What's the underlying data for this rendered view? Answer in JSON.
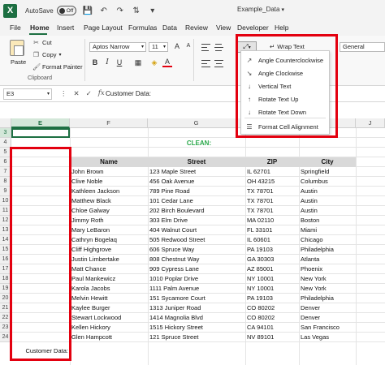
{
  "titlebar": {
    "logo": "X",
    "autosave_label": "AutoSave",
    "toggle_state": "Off",
    "filename": "Example_Data",
    "icons": [
      "save-icon",
      "undo-icon",
      "redo-icon",
      "sort-icon",
      "customize-icon"
    ]
  },
  "menu": {
    "tabs": [
      "File",
      "Home",
      "Insert",
      "Page Layout",
      "Formulas",
      "Data",
      "Review",
      "View",
      "Developer",
      "Help"
    ],
    "active": "Home"
  },
  "ribbon": {
    "paste_label": "Paste",
    "cut_label": "Cut",
    "copy_label": "Copy",
    "format_painter_label": "Format Painter",
    "clipboard_group": "Clipboard",
    "font_name": "Aptos Narrow",
    "font_size": "11",
    "font_group": "Font",
    "bold": "B",
    "italic": "I",
    "underline": "U",
    "grow_font": "A",
    "shrink_font": "A",
    "font_color_letter": "A",
    "wrap_text_label": "Wrap Text",
    "number_format": "General",
    "accent_color": "#1d6f42"
  },
  "orientation_menu": {
    "items": [
      "Angle Counterclockwise",
      "Angle Clockwise",
      "Vertical Text",
      "Rotate Text Up",
      "Rotate Text Down",
      "Format Cell Alignment"
    ]
  },
  "formula_bar": {
    "cell_ref": "E3",
    "content": "Customer Data:"
  },
  "sheet": {
    "columns": [
      "E",
      "F",
      "G",
      "H",
      "I",
      "J"
    ],
    "selected_column": "E",
    "rows": [
      "3",
      "4",
      "5",
      "6",
      "7",
      "8",
      "9",
      "10",
      "11",
      "12",
      "13",
      "14",
      "15",
      "16",
      "17",
      "18",
      "19",
      "20",
      "21",
      "22",
      "23",
      "24"
    ],
    "clean_label": "CLEAN:",
    "table_headers": [
      "Name",
      "Street",
      "ZIP",
      "City"
    ],
    "table_rows": [
      [
        "John Brown",
        "123 Maple Street",
        "IL 62701",
        "Springfield"
      ],
      [
        "Clive Noble",
        "456 Oak Avenue",
        "OH 43215",
        "Columbus"
      ],
      [
        "Kathleen Jackson",
        "789 Pine Road",
        "TX 78701",
        "Austin"
      ],
      [
        "Matthew Black",
        "101 Cedar Lane",
        "TX 78701",
        "Austin"
      ],
      [
        "Chloe Galway",
        "202 Birch Boulevard",
        "TX 78701",
        "Austin"
      ],
      [
        "Jimmy Roth",
        "303 Elm Drive",
        "MA 02110",
        "Boston"
      ],
      [
        "Mary LeBaron",
        "404 Walnut Court",
        "FL 33101",
        "Miami"
      ],
      [
        "Cathryn Bogelaq",
        "505 Redwood Street",
        "IL 60601",
        "Chicago"
      ],
      [
        "Cliff Highgrove",
        "606 Spruce Way",
        "PA 19103",
        "Philadelphia"
      ],
      [
        "Justin Limbertake",
        "808 Chestnut Way",
        "GA 30303",
        "Atlanta"
      ],
      [
        "Matt Chance",
        "909 Cypress Lane",
        "AZ 85001",
        "Phoenix"
      ],
      [
        "Paul Mankewicz",
        "1010 Poplar Drive",
        "NY 10001",
        "New York"
      ],
      [
        "Karola Jacobs",
        "1111 Palm Avenue",
        "NY 10001",
        "New York"
      ],
      [
        "Melvin Hewitt",
        "151 Sycamore Court",
        "PA 19103",
        "Philadelphia"
      ],
      [
        "Kaylee Burger",
        "1313 Juniper Road",
        "CO 80202",
        "Denver"
      ],
      [
        "Stewart Lockwood",
        "1414 Magnolia Blvd",
        "CO 80202",
        "Denver"
      ],
      [
        "Kellen Hickory",
        "1515 Hickory Street",
        "CA 94101",
        "San Francisco"
      ],
      [
        "Glen Hampcott",
        "121 Spruce Street",
        "NV 89101",
        "Las Vegas"
      ]
    ],
    "customer_label": "Customer Data:"
  }
}
